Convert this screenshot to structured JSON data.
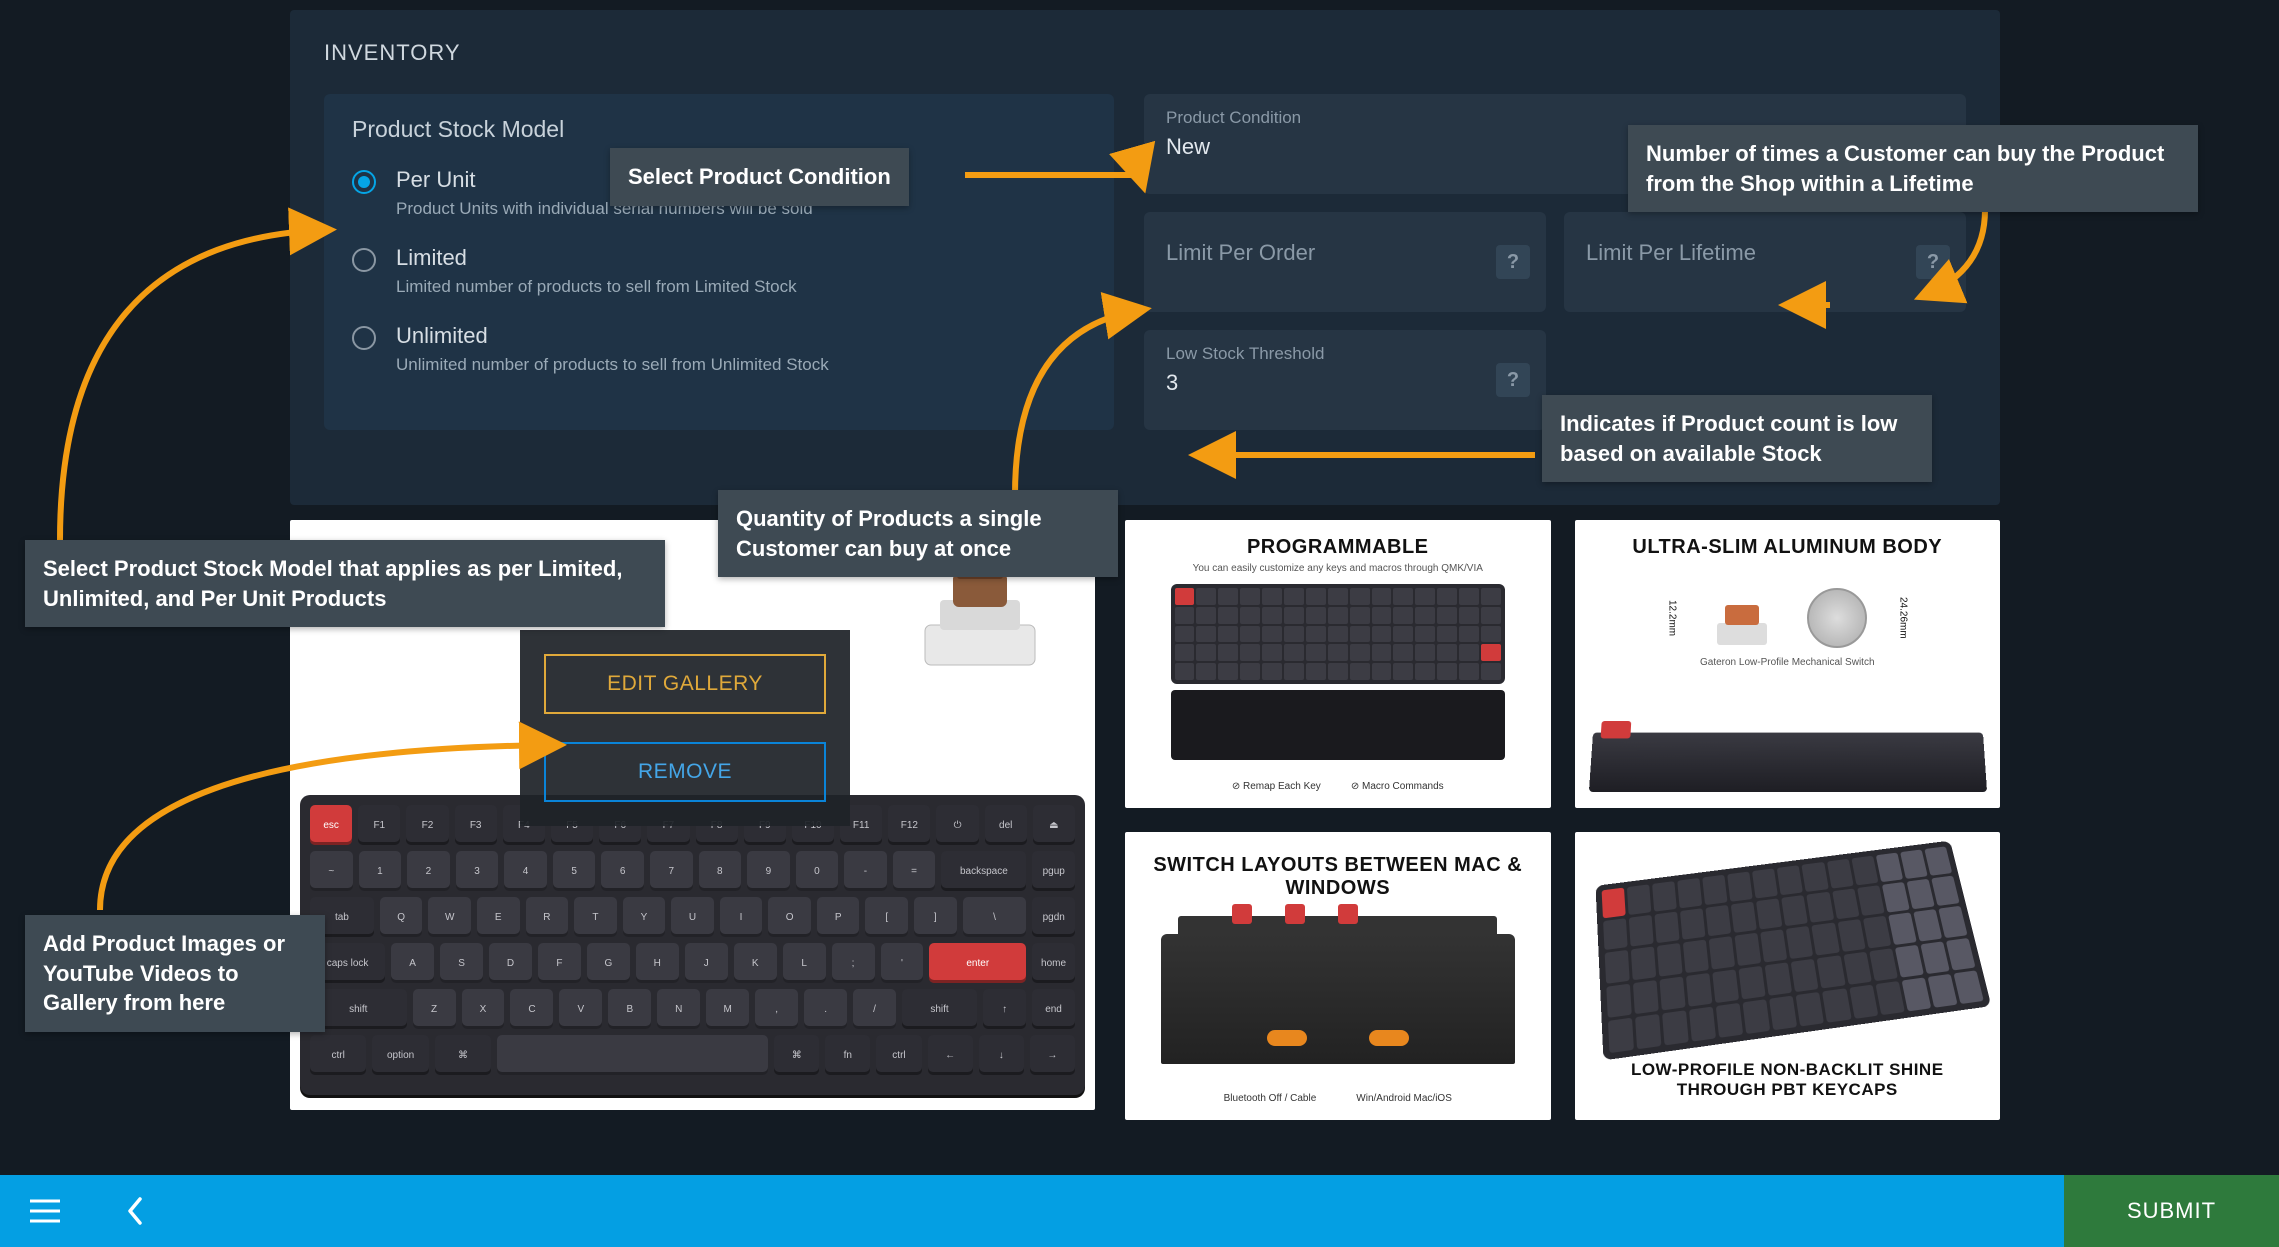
{
  "panel": {
    "title": "INVENTORY",
    "stock_model": {
      "heading": "Product Stock Model",
      "options": [
        {
          "label": "Per Unit",
          "desc": "Product Units with individual serial numbers will be sold",
          "selected": true
        },
        {
          "label": "Limited",
          "desc": "Limited number of products to sell from Limited Stock",
          "selected": false
        },
        {
          "label": "Unlimited",
          "desc": "Unlimited number of products to sell from Unlimited Stock",
          "selected": false
        }
      ]
    },
    "fields": {
      "product_condition": {
        "label": "Product Condition",
        "value": "New"
      },
      "limit_per_order": {
        "label": "Limit Per Order",
        "placeholder": "?"
      },
      "limit_per_lifetime": {
        "label": "Limit Per Lifetime",
        "placeholder": "?"
      },
      "low_stock_threshold": {
        "label": "Low Stock Threshold",
        "value": "3",
        "placeholder": "?"
      }
    }
  },
  "gallery": {
    "edit_label": "EDIT GALLERY",
    "remove_label": "REMOVE",
    "thumbs": [
      {
        "title": "PROGRAMMABLE",
        "sub": "You can easily customize any keys and macros through QMK/VIA",
        "foot_left": "Remap Each Key",
        "foot_right": "Macro Commands"
      },
      {
        "title": "ULTRA-SLIM ALUMINUM BODY",
        "sub_left": "12.2mm",
        "sub_right": "24.26mm",
        "caption": "Gateron Low-Profile Mechanical Switch"
      },
      {
        "title": "SWITCH LAYOUTS BETWEEN MAC & WINDOWS",
        "foot_left": "Bluetooth Off / Cable",
        "foot_right": "Win/Android  Mac/iOS"
      },
      {
        "title_bottom": "LOW-PROFILE NON-BACKLIT SHINE THROUGH PBT KEYCAPS"
      }
    ]
  },
  "callouts": {
    "select_condition": "Select Product Condition",
    "lifetime": "Number of times a Customer can buy the Product from the Shop within a Lifetime",
    "per_order": "Quantity of Products a single Customer can buy at once",
    "low_stock": "Indicates if Product count is low based on available Stock",
    "stock_model": "Select Product Stock Model that applies as per Limited, Unlimited, and Per Unit Products",
    "gallery": "Add Product Images or YouTube Videos to Gallery from here"
  },
  "bottom": {
    "submit": "SUBMIT"
  }
}
